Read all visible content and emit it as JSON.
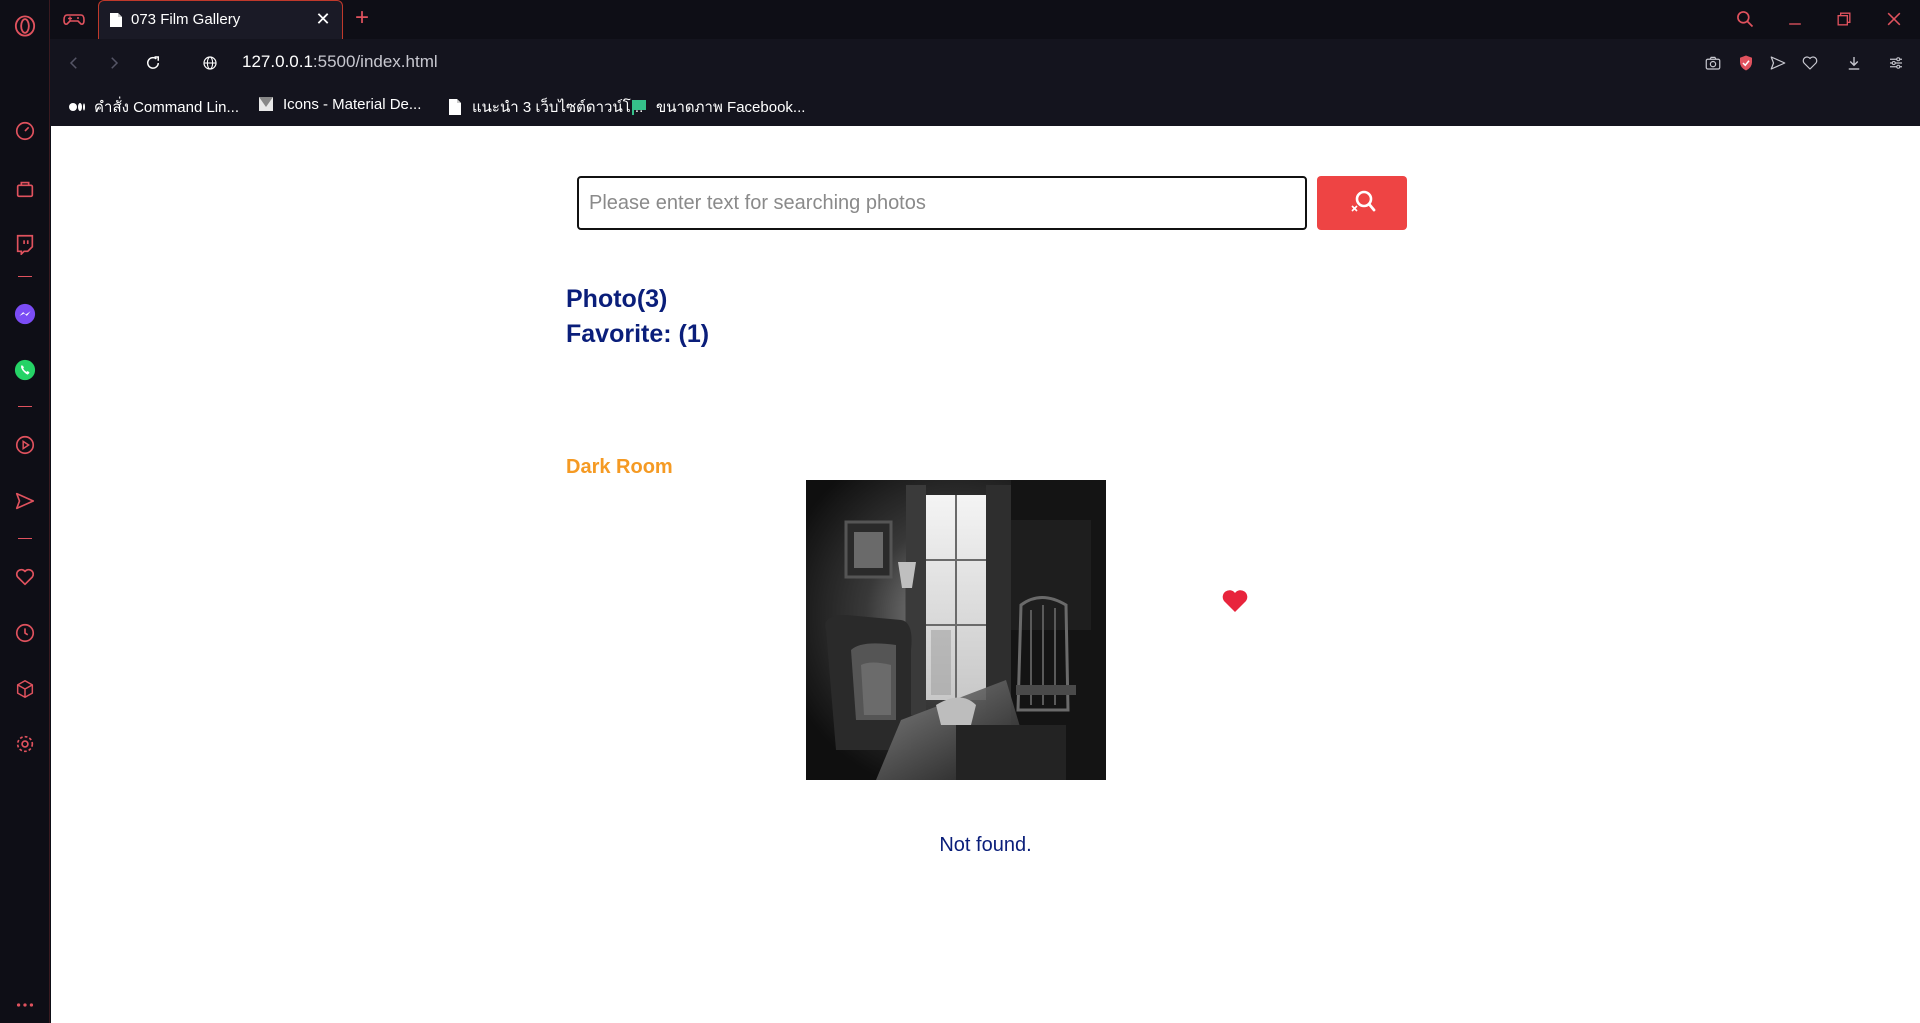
{
  "browser": {
    "tab_title": "073 Film Gallery",
    "url_host": "127.0.0.1",
    "url_rest": ":5500/index.html"
  },
  "bookmarks": [
    {
      "label": "คำสั่ง Command Lin...",
      "icon": "medium-icon"
    },
    {
      "label": "Icons - Material De...",
      "icon": "material-icon"
    },
    {
      "label": "แนะนำ 3 เว็บไซต์ดาวน์โ...",
      "icon": "document-icon"
    },
    {
      "label": "ขนาดภาพ Facebook...",
      "icon": "flag-icon"
    }
  ],
  "search": {
    "placeholder": "Please enter text for searching photos",
    "value": ""
  },
  "counts": {
    "photo": "Photo(3)",
    "favorite": "Favorite: (1)"
  },
  "photo": {
    "title": "Dark Room",
    "favorited": true
  },
  "status": {
    "not_found": "Not found."
  },
  "colors": {
    "accent": "#e0525e",
    "search_button": "#ee4444",
    "heading": "#0a1e7a",
    "photo_title": "#f59a23",
    "heart": "#e8243c"
  }
}
